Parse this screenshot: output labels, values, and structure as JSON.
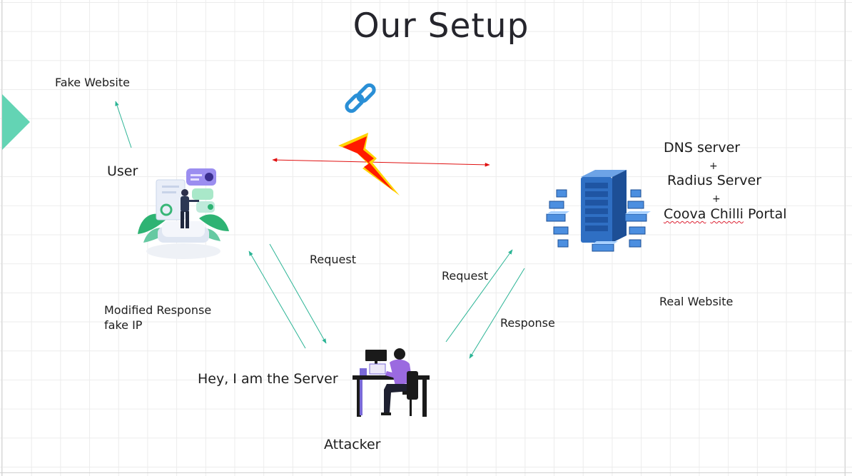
{
  "title": "Our Setup",
  "nodes": {
    "fake_website": "Fake  Website",
    "user": "User",
    "attacker": "Attacker",
    "attacker_quote": "Hey, I am the Server",
    "server_stack": {
      "line1": "DNS server",
      "plus1": "+",
      "line2": "Radius Server",
      "plus2": "+",
      "line3_part1": "Coova",
      "line3_part2": "Chilli",
      "line3_part3": "Portal"
    },
    "real_website": "Real Website"
  },
  "edges": {
    "request_left": "Request",
    "request_right": "Request",
    "response_right": "Response",
    "modified_response_line1": "Modified Response",
    "modified_response_line2": "fake IP"
  },
  "colors": {
    "arrow_teal": "#2bb495",
    "arrow_red": "#e01010",
    "lightning_red": "#ff1a00",
    "lightning_yellow": "#ffd400",
    "link_blue": "#2a8fd6",
    "server_blue": "#2f6fc3",
    "accent_purple": "#9b6ae0",
    "accent_green": "#38b677",
    "teal_triangle": "#63d4b4"
  },
  "icons": {
    "link": "link-chain-icon",
    "lightning": "lightning-bolt-icon",
    "user": "user-dashboard-illustration",
    "server": "server-rack-illustration",
    "attacker": "person-at-computer-illustration"
  }
}
